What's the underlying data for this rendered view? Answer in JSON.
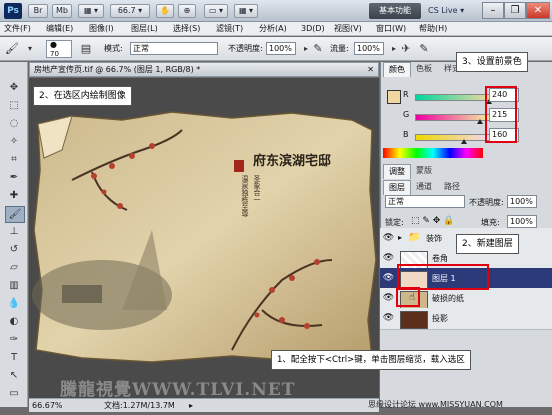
{
  "titlebar": {
    "app_logo": "Ps",
    "buttons": [
      "Br",
      "Mb",
      "▦ ▾",
      "66.7 ▾",
      "✋",
      "⊕",
      "▭ ▾",
      "▦ ▾"
    ],
    "workspace": "基本功能",
    "cslive": "CS Live ▾",
    "window_controls": [
      "–",
      "❐",
      "✕"
    ]
  },
  "menu": [
    "文件(F)",
    "编辑(E)",
    "图像(I)",
    "图层(L)",
    "选择(S)",
    "滤镜(T)",
    "分析(A)",
    "3D(D)",
    "视图(V)",
    "窗口(W)",
    "帮助(H)"
  ],
  "options": {
    "brush_size": "70",
    "mode_label": "模式:",
    "mode_value": "正常",
    "opacity_label": "不透明度:",
    "opacity_value": "100%",
    "flow_label": "流量:",
    "flow_value": "100%"
  },
  "document": {
    "tab_title": "房地产宣传页.tif @ 66.7% (图层 1, RGB/8) *",
    "zoom": "66.67%",
    "doc_info": "文档:1.27M/13.7M",
    "art_title": "府东滨湖宅邸",
    "art_vertical_1": "温泉独栋至尊",
    "art_vertical_2": "圣象合一",
    "watermark": "騰龍視覺WWW.TLVI.NET"
  },
  "color_panel": {
    "tabs": [
      "颜色",
      "色板",
      "样式"
    ],
    "r_label": "R",
    "r_value": "240",
    "g_label": "G",
    "g_value": "215",
    "b_label": "B",
    "b_value": "160",
    "foreground": "#f0d7a0"
  },
  "adjust_tabs": [
    "调整",
    "蒙版"
  ],
  "layers_panel": {
    "tabs": [
      "图层",
      "通道",
      "路径"
    ],
    "blend_mode": "正常",
    "opacity_label": "不透明度:",
    "opacity_value": "100%",
    "lock_label": "锁定:",
    "fill_label": "填充:",
    "fill_value": "100%",
    "layers": [
      {
        "name": "装饰",
        "selected": false
      },
      {
        "name": "卷角",
        "selected": false
      },
      {
        "name": "图层 1",
        "selected": true
      },
      {
        "name": "破损的纸",
        "selected": false
      },
      {
        "name": "投影",
        "selected": false
      }
    ]
  },
  "annotations": {
    "step1": "1、配全按下<Ctrl>键，单击图层缩览，载入选区",
    "step2": "2、在选区内绘制图像",
    "step3": "3、设置前景色",
    "new_layer": "2、新建图层",
    "footer_watermark": "思缘设计论坛 www.MISSYUAN.COM"
  },
  "colors": {
    "accent_red": "#e00010",
    "selected_layer": "#2c3a7a"
  }
}
